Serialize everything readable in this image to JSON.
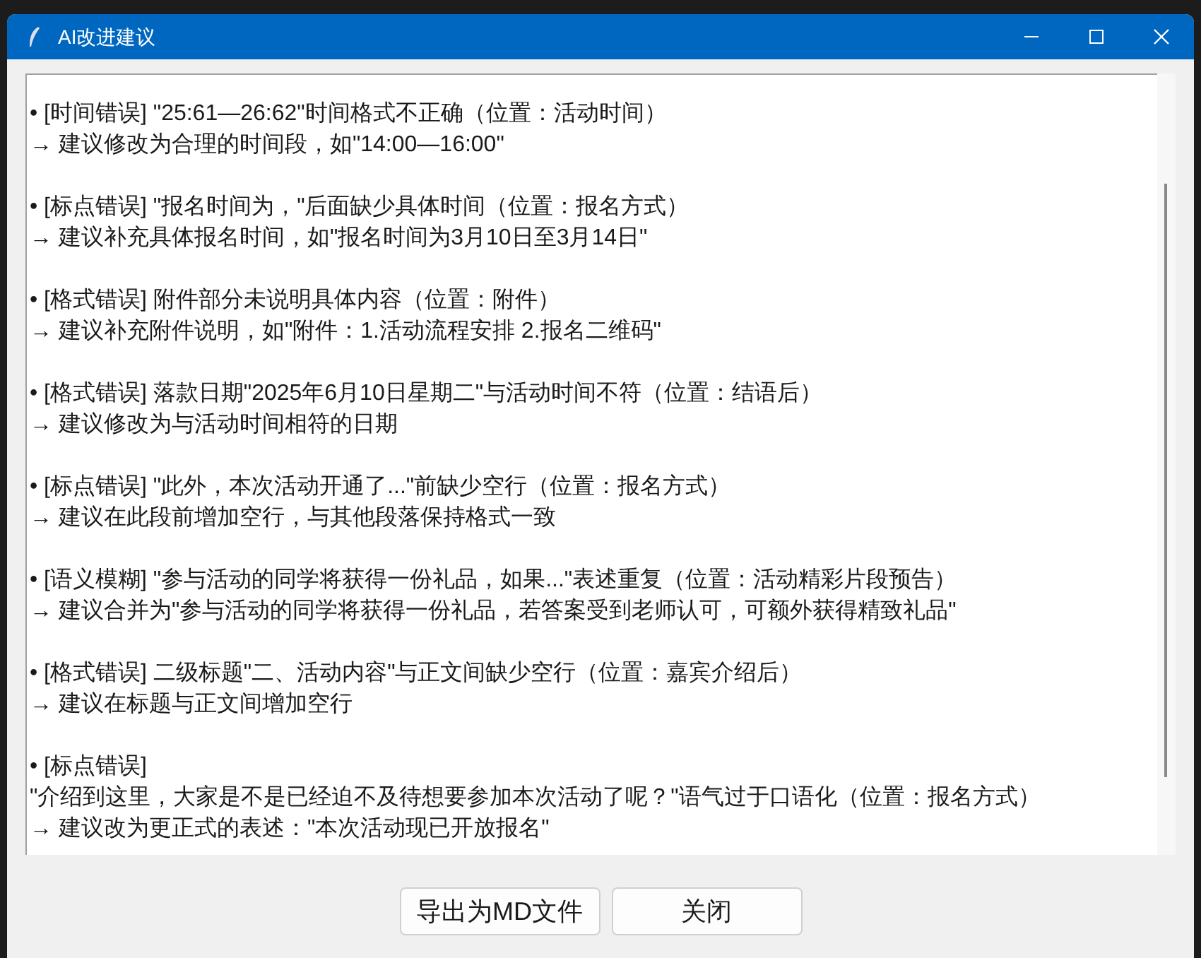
{
  "window": {
    "title": "AI改进建议"
  },
  "items": [
    {
      "lines": [
        "• [时间错误] \"25:61—26:62\"时间格式不正确（位置：活动时间）",
        "→ 建议修改为合理的时间段，如\"14:00—16:00\""
      ]
    },
    {
      "lines": [
        "• [标点错误] \"报名时间为，\"后面缺少具体时间（位置：报名方式）",
        "→ 建议补充具体报名时间，如\"报名时间为3月10日至3月14日\""
      ]
    },
    {
      "lines": [
        "• [格式错误] 附件部分未说明具体内容（位置：附件）",
        "→ 建议补充附件说明，如\"附件：1.活动流程安排 2.报名二维码\""
      ]
    },
    {
      "lines": [
        "• [格式错误] 落款日期\"2025年6月10日星期二\"与活动时间不符（位置：结语后）",
        "→ 建议修改为与活动时间相符的日期"
      ]
    },
    {
      "lines": [
        "• [标点错误] \"此外，本次活动开通了...\"前缺少空行（位置：报名方式）",
        "→ 建议在此段前增加空行，与其他段落保持格式一致"
      ]
    },
    {
      "lines": [
        "• [语义模糊] \"参与活动的同学将获得一份礼品，如果...\"表述重复（位置：活动精彩片段预告）",
        "→ 建议合并为\"参与活动的同学将获得一份礼品，若答案受到老师认可，可额外获得精致礼品\""
      ]
    },
    {
      "lines": [
        "• [格式错误] 二级标题\"二、活动内容\"与正文间缺少空行（位置：嘉宾介绍后）",
        "→ 建议在标题与正文间增加空行"
      ]
    },
    {
      "lines": [
        "• [标点错误]",
        "\"介绍到这里，大家是不是已经迫不及待想要参加本次活动了呢？\"语气过于口语化（位置：报名方式）",
        "→ 建议改为更正式的表述：\"本次活动现已开放报名\""
      ]
    }
  ],
  "buttons": [
    "导出为MD文件",
    "关闭"
  ]
}
